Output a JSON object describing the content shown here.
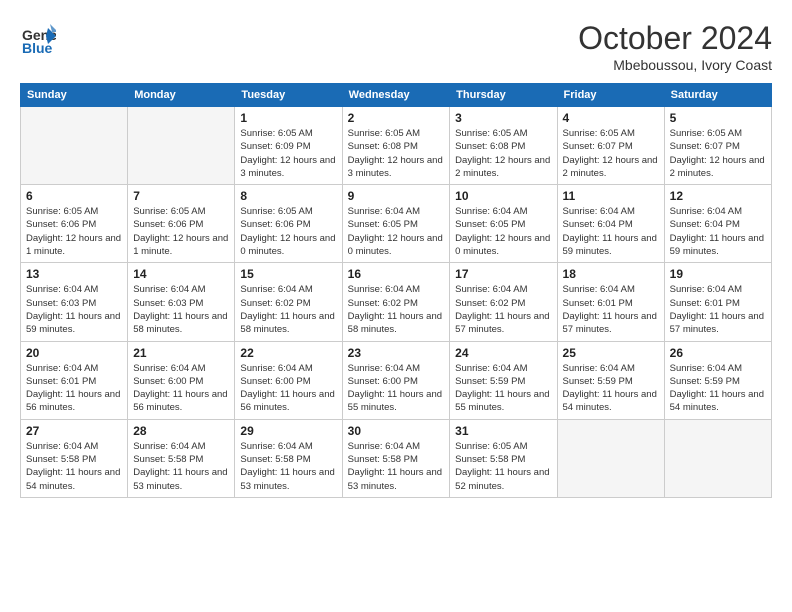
{
  "header": {
    "logo_general": "General",
    "logo_blue": "Blue",
    "month_title": "October 2024",
    "location": "Mbeboussou, Ivory Coast"
  },
  "days_of_week": [
    "Sunday",
    "Monday",
    "Tuesday",
    "Wednesday",
    "Thursday",
    "Friday",
    "Saturday"
  ],
  "weeks": [
    [
      {
        "day": "",
        "info": ""
      },
      {
        "day": "",
        "info": ""
      },
      {
        "day": "1",
        "info": "Sunrise: 6:05 AM\nSunset: 6:09 PM\nDaylight: 12 hours and 3 minutes."
      },
      {
        "day": "2",
        "info": "Sunrise: 6:05 AM\nSunset: 6:08 PM\nDaylight: 12 hours and 3 minutes."
      },
      {
        "day": "3",
        "info": "Sunrise: 6:05 AM\nSunset: 6:08 PM\nDaylight: 12 hours and 2 minutes."
      },
      {
        "day": "4",
        "info": "Sunrise: 6:05 AM\nSunset: 6:07 PM\nDaylight: 12 hours and 2 minutes."
      },
      {
        "day": "5",
        "info": "Sunrise: 6:05 AM\nSunset: 6:07 PM\nDaylight: 12 hours and 2 minutes."
      }
    ],
    [
      {
        "day": "6",
        "info": "Sunrise: 6:05 AM\nSunset: 6:06 PM\nDaylight: 12 hours and 1 minute."
      },
      {
        "day": "7",
        "info": "Sunrise: 6:05 AM\nSunset: 6:06 PM\nDaylight: 12 hours and 1 minute."
      },
      {
        "day": "8",
        "info": "Sunrise: 6:05 AM\nSunset: 6:06 PM\nDaylight: 12 hours and 0 minutes."
      },
      {
        "day": "9",
        "info": "Sunrise: 6:04 AM\nSunset: 6:05 PM\nDaylight: 12 hours and 0 minutes."
      },
      {
        "day": "10",
        "info": "Sunrise: 6:04 AM\nSunset: 6:05 PM\nDaylight: 12 hours and 0 minutes."
      },
      {
        "day": "11",
        "info": "Sunrise: 6:04 AM\nSunset: 6:04 PM\nDaylight: 11 hours and 59 minutes."
      },
      {
        "day": "12",
        "info": "Sunrise: 6:04 AM\nSunset: 6:04 PM\nDaylight: 11 hours and 59 minutes."
      }
    ],
    [
      {
        "day": "13",
        "info": "Sunrise: 6:04 AM\nSunset: 6:03 PM\nDaylight: 11 hours and 59 minutes."
      },
      {
        "day": "14",
        "info": "Sunrise: 6:04 AM\nSunset: 6:03 PM\nDaylight: 11 hours and 58 minutes."
      },
      {
        "day": "15",
        "info": "Sunrise: 6:04 AM\nSunset: 6:02 PM\nDaylight: 11 hours and 58 minutes."
      },
      {
        "day": "16",
        "info": "Sunrise: 6:04 AM\nSunset: 6:02 PM\nDaylight: 11 hours and 58 minutes."
      },
      {
        "day": "17",
        "info": "Sunrise: 6:04 AM\nSunset: 6:02 PM\nDaylight: 11 hours and 57 minutes."
      },
      {
        "day": "18",
        "info": "Sunrise: 6:04 AM\nSunset: 6:01 PM\nDaylight: 11 hours and 57 minutes."
      },
      {
        "day": "19",
        "info": "Sunrise: 6:04 AM\nSunset: 6:01 PM\nDaylight: 11 hours and 57 minutes."
      }
    ],
    [
      {
        "day": "20",
        "info": "Sunrise: 6:04 AM\nSunset: 6:01 PM\nDaylight: 11 hours and 56 minutes."
      },
      {
        "day": "21",
        "info": "Sunrise: 6:04 AM\nSunset: 6:00 PM\nDaylight: 11 hours and 56 minutes."
      },
      {
        "day": "22",
        "info": "Sunrise: 6:04 AM\nSunset: 6:00 PM\nDaylight: 11 hours and 56 minutes."
      },
      {
        "day": "23",
        "info": "Sunrise: 6:04 AM\nSunset: 6:00 PM\nDaylight: 11 hours and 55 minutes."
      },
      {
        "day": "24",
        "info": "Sunrise: 6:04 AM\nSunset: 5:59 PM\nDaylight: 11 hours and 55 minutes."
      },
      {
        "day": "25",
        "info": "Sunrise: 6:04 AM\nSunset: 5:59 PM\nDaylight: 11 hours and 54 minutes."
      },
      {
        "day": "26",
        "info": "Sunrise: 6:04 AM\nSunset: 5:59 PM\nDaylight: 11 hours and 54 minutes."
      }
    ],
    [
      {
        "day": "27",
        "info": "Sunrise: 6:04 AM\nSunset: 5:58 PM\nDaylight: 11 hours and 54 minutes."
      },
      {
        "day": "28",
        "info": "Sunrise: 6:04 AM\nSunset: 5:58 PM\nDaylight: 11 hours and 53 minutes."
      },
      {
        "day": "29",
        "info": "Sunrise: 6:04 AM\nSunset: 5:58 PM\nDaylight: 11 hours and 53 minutes."
      },
      {
        "day": "30",
        "info": "Sunrise: 6:04 AM\nSunset: 5:58 PM\nDaylight: 11 hours and 53 minutes."
      },
      {
        "day": "31",
        "info": "Sunrise: 6:05 AM\nSunset: 5:58 PM\nDaylight: 11 hours and 52 minutes."
      },
      {
        "day": "",
        "info": ""
      },
      {
        "day": "",
        "info": ""
      }
    ]
  ]
}
